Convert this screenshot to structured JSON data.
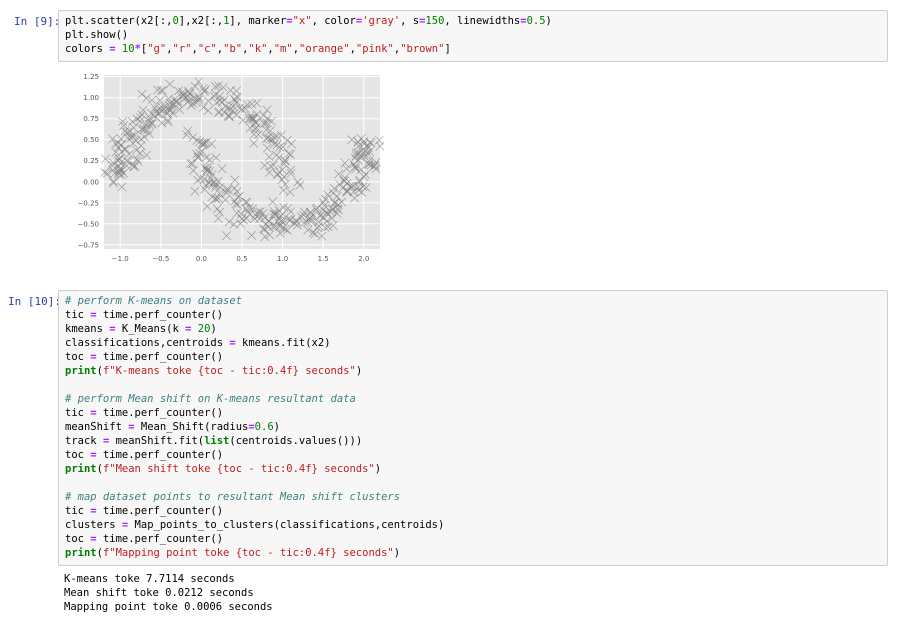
{
  "cells": [
    {
      "prompt": "In [9]:",
      "code_lines": [
        "plt.scatter(x2[:,0],x2[:,1], marker=\"x\", color='gray', s=150, linewidths=0.5)",
        "plt.show()",
        "colors = 10*[\"g\",\"r\",\"c\",\"b\",\"k\",\"m\",\"orange\",\"pink\",\"brown\"]"
      ]
    },
    {
      "prompt": "In [10]:",
      "code_lines": [
        "# perform K-means on dataset",
        "tic = time.perf_counter()",
        "kmeans = K_Means(k = 20)",
        "classifications,centroids = kmeans.fit(x2)",
        "toc = time.perf_counter()",
        "print(f\"K-means toke {toc - tic:0.4f} seconds\")",
        "",
        "# perform Mean shift on K-means resultant data",
        "tic = time.perf_counter()",
        "meanShift = Mean_Shift(radius=0.6)",
        "track = meanShift.fit(list(centroids.values()))",
        "toc = time.perf_counter()",
        "print(f\"Mean shift toke {toc - tic:0.4f} seconds\")",
        "",
        "# map dataset points to resultant Mean shift clusters",
        "tic = time.perf_counter()",
        "clusters = Map_points_to_clusters(classifications,centroids)",
        "toc = time.perf_counter()",
        "print(f\"Mapping point toke {toc - tic:0.4f} seconds\")"
      ],
      "output_lines": [
        "K-means toke 7.7114 seconds",
        "Mean shift toke 0.0212 seconds",
        "Mapping point toke 0.0006 seconds"
      ]
    }
  ],
  "chart_data": {
    "type": "scatter",
    "marker": "x",
    "color": "#808080",
    "background": "#e5e5e5",
    "grid": true,
    "xlim": [
      -1.2,
      2.2
    ],
    "ylim": [
      -0.8,
      1.27
    ],
    "x_ticks": [
      -1.0,
      -0.5,
      0.0,
      0.5,
      1.0,
      1.5,
      2.0
    ],
    "x_tick_labels": [
      "−1.0",
      "−0.5",
      "0.0",
      "0.5",
      "1.0",
      "1.5",
      "2.0"
    ],
    "y_ticks": [
      1.25,
      1.0,
      0.75,
      0.5,
      0.25,
      0.0,
      -0.25,
      -0.5,
      -0.75
    ],
    "y_tick_labels": [
      "1.25",
      "1.00",
      "0.75",
      "0.50",
      "0.25",
      "0.00",
      "−0.25",
      "−0.50",
      "−0.75"
    ],
    "shape": "two interleaving half-moons",
    "moons": [
      {
        "center": [
          0.0,
          0.0
        ],
        "radius": 1.0,
        "angle_start_deg": 0,
        "angle_end_deg": 180,
        "direction": "upper"
      },
      {
        "center": [
          1.0,
          0.5
        ],
        "radius": 1.0,
        "angle_start_deg": 180,
        "angle_end_deg": 360,
        "direction": "lower"
      }
    ],
    "noise": 0.1,
    "points_per_moon": 240
  }
}
